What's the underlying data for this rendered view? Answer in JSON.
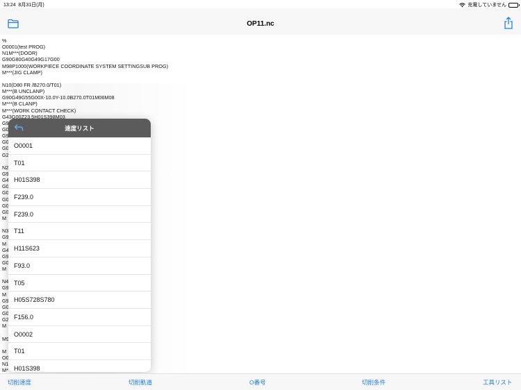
{
  "status_bar": {
    "time": "13:24",
    "date": "8月31日(月)",
    "charging": "充電していません",
    "wifi_icon": "wifi-icon",
    "battery_icon": "battery-icon"
  },
  "nav": {
    "title": "OP11.nc",
    "left_icon": "folder-icon",
    "right_icon": "share-icon"
  },
  "code_lines": [
    "%",
    "O0001(test PROG)",
    "N1M***(DOOR)",
    "G90G80G40G49G17G00",
    "M98P1000(WORKPIECE COORDINATE SYSTEM SETTINGSUB PROG)",
    "M***(JIG CLAMP)",
    "",
    "N10(D80 FR /B270.0/T01)",
    "M***(B UNCLANP)",
    "G90G49G55G00X-10.0Y-10.0B270.0T01M06M08",
    "M***(B CLANP)",
    "M***(WORK CONTACT CHECK)",
    "G43G00Z23.5H01S398M03",
    "G9",
    "G0",
    "G9",
    "G0",
    "G0",
    "G2",
    "",
    "N2",
    "G9",
    "G4",
    "G0",
    "G0",
    "G0",
    "G0",
    "G0",
    "M",
    "",
    "N3",
    "G9",
    "M",
    "G4",
    "G9",
    "G0",
    "M",
    "",
    "N4",
    "G9",
    "M",
    "G9",
    "G0",
    "G0",
    "G2",
    "M",
    "",
    "M9",
    "",
    "M",
    "O0",
    "N1",
    "M*"
  ],
  "popover": {
    "title": "速度リスト",
    "back_icon": "back-arrow-icon",
    "items": [
      "O0001",
      "T01",
      "H01S398",
      "F239.0",
      "F239.0",
      "T11",
      "H11S623",
      "F93.0",
      "T05",
      "H05S728S780",
      "F156.0",
      "O0002",
      "T01",
      "H01S398"
    ]
  },
  "tabs": [
    "切削速度",
    "切削軌道",
    "O番号",
    "切削条件",
    "工具リスト"
  ],
  "colors": {
    "accent": "#1e7cf2",
    "popover_header": "#5b5b5b"
  }
}
